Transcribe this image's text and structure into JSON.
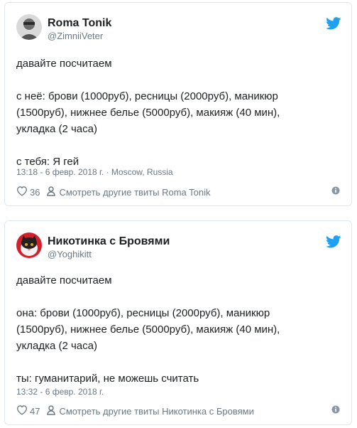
{
  "colors": {
    "brand_blue": "#1da1f2",
    "secondary_text": "#697882",
    "border": "#e1e8ed"
  },
  "tweets": [
    {
      "name": "Roma Tonik",
      "handle": "@ZimniiVeter",
      "text": "давайте посчитаем\n\nс неё: брови (1000руб), ресницы (2000руб), маникюр\n(1500руб), нижнее белье (5000руб), макияж (40 мин),\nукладка (2 часа)\n\nс тебя: Я гей",
      "meta": "13:18 - 6 февр. 2018 г. · Moscow, Russia",
      "likes": "36",
      "more_label": "Смотреть другие твиты Roma Tonik",
      "icons": [
        "avatar",
        "twitter-bird-icon",
        "heart-icon",
        "person-icon",
        "info-icon"
      ]
    },
    {
      "name": "Никотинка с Бровями",
      "handle": "@Yoghikitt",
      "text": "давайте посчитаем\n\nона: брови (1000руб), ресницы (2000руб), маникюр\n(1500руб), нижнее белье (5000руб), макияж (40 мин),\nукладка (2 часа)\n\nты: гуманитарий, не можешь считать",
      "meta": "13:32 - 6 февр. 2018 г.",
      "likes": "47",
      "more_label": "Смотреть другие твиты Никотинка с Бровями",
      "icons": [
        "avatar",
        "twitter-bird-icon",
        "heart-icon",
        "person-icon",
        "info-icon"
      ]
    }
  ]
}
